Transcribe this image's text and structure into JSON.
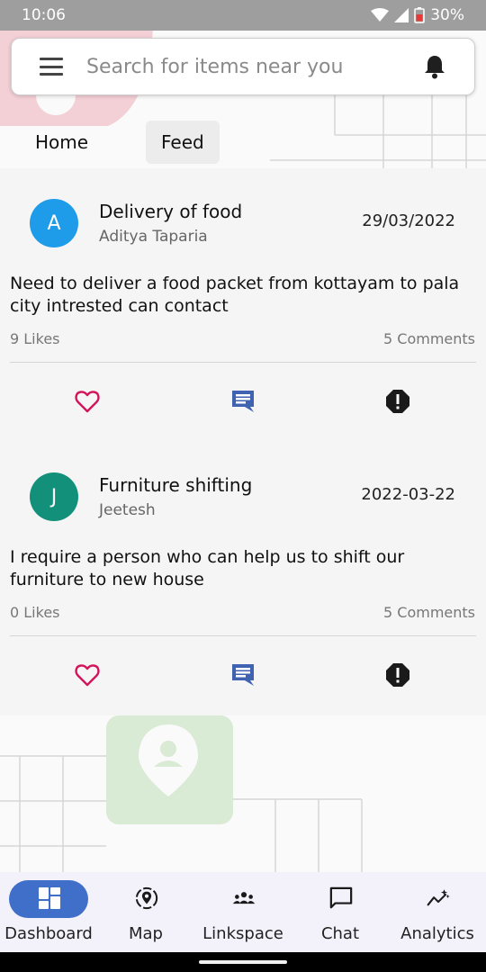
{
  "status_bar": {
    "time": "10:06",
    "battery": "30%"
  },
  "search": {
    "placeholder": "Search for items near you"
  },
  "tabs": [
    {
      "label": "Home"
    },
    {
      "label": "Feed"
    }
  ],
  "posts": [
    {
      "avatar_letter": "A",
      "avatar_color": "#1e9be9",
      "title": "Delivery of food",
      "author": "Aditya Taparia",
      "date": "29/03/2022",
      "body": "Need to deliver a food packet from kottayam to pala city intrested can contact",
      "likes": "9 Likes",
      "comments": "5 Comments"
    },
    {
      "avatar_letter": "J",
      "avatar_color": "#12907a",
      "title": "Furniture shifting",
      "author": "Jeetesh",
      "date": "2022-03-22",
      "body": "I require a person who can help us to shift our furniture to new house",
      "likes": "0 Likes",
      "comments": "5 Comments"
    }
  ],
  "bottom_nav": [
    {
      "label": "Dashboard",
      "icon": "dashboard-icon",
      "active": true
    },
    {
      "label": "Map",
      "icon": "map-pin-icon"
    },
    {
      "label": "Linkspace",
      "icon": "people-icon"
    },
    {
      "label": "Chat",
      "icon": "chat-icon"
    },
    {
      "label": "Analytics",
      "icon": "analytics-icon"
    }
  ],
  "colors": {
    "accent": "#3f6fc9",
    "like": "#d4145a",
    "comment": "#3f63b0",
    "report": "#1a1a1a"
  }
}
